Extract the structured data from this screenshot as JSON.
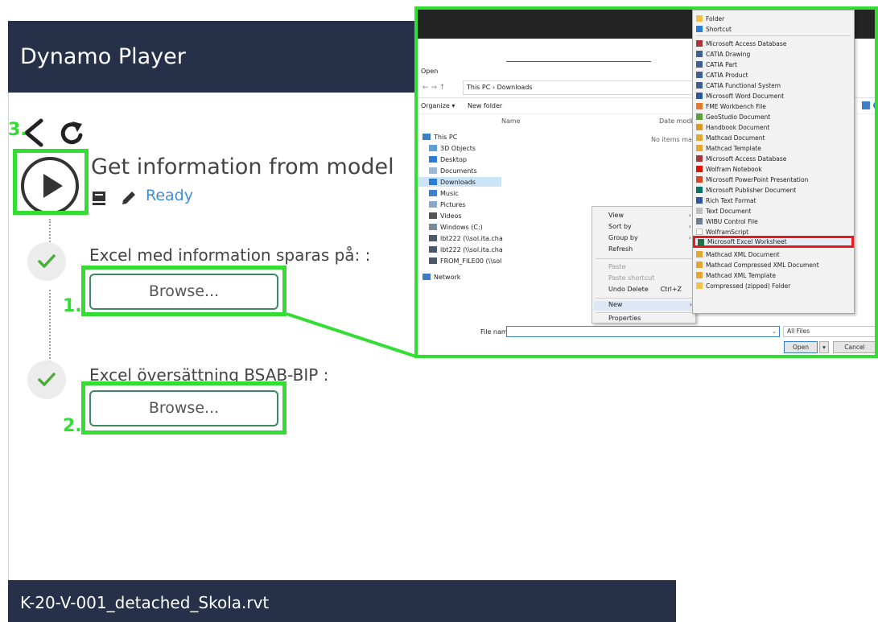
{
  "player": {
    "title": "Dynamo Player",
    "script_title": "Get information from model",
    "status": "Ready",
    "inputs": [
      {
        "label": "Excel med information sparas på: :",
        "button": "Browse..."
      },
      {
        "label": "Excel översättning BSAB-BIP :",
        "button": "Browse..."
      }
    ],
    "footer_file": "K-20-V-001_detached_Skola.rvt"
  },
  "annotations": {
    "n1": "1.",
    "n2": "2.",
    "n3": "3."
  },
  "explorer": {
    "window_title": "Open",
    "breadcrumb": "This PC  ›  Downloads",
    "organize": "Organize ▾",
    "new_folder": "New folder",
    "col_name": "Name",
    "col_date": "Date modifie",
    "no_items": "No items match",
    "nav": [
      "This PC",
      "3D Objects",
      "Desktop",
      "Documents",
      "Downloads",
      "Music",
      "Pictures",
      "Videos",
      "Windows (C:)",
      "lbt222 (\\\\sol.ita.cha",
      "lbt222 (\\\\sol.ita.cha",
      "FROM_FILE00 (\\\\sol",
      "Network"
    ],
    "context_menu": {
      "view": "View",
      "sort_by": "Sort by",
      "group_by": "Group by",
      "refresh": "Refresh",
      "paste": "Paste",
      "paste_shortcut": "Paste shortcut",
      "undo_delete": "Undo Delete",
      "undo_shortcut": "Ctrl+Z",
      "new": "New",
      "properties": "Properties"
    },
    "new_menu": [
      "Folder",
      "Shortcut",
      "Microsoft Access Database",
      "CATIA Drawing",
      "CATIA Part",
      "CATIA Product",
      "CATIA Functional System",
      "Microsoft Word Document",
      "FME Workbench File",
      "GeoStudio Document",
      "Handbook Document",
      "Mathcad Document",
      "Mathcad Template",
      "Microsoft Access Database",
      "Wolfram Notebook",
      "Microsoft PowerPoint Presentation",
      "Microsoft Publisher Document",
      "Rich Text Format",
      "Text Document",
      "WIBU Control File",
      "WolframScript",
      "Microsoft Excel Worksheet",
      "Mathcad XML Document",
      "Mathcad Compressed XML Document",
      "Mathcad XML Template",
      "Compressed (zipped) Folder"
    ],
    "file_name_label": "File name:",
    "filter": "All Files",
    "open_label": "Open",
    "cancel_label": "Cancel"
  },
  "colors": {
    "header_bg": "#263049",
    "highlight": "#33dd33",
    "status_blue": "#3e8ddd",
    "excel_outline": "#e11d1d"
  }
}
